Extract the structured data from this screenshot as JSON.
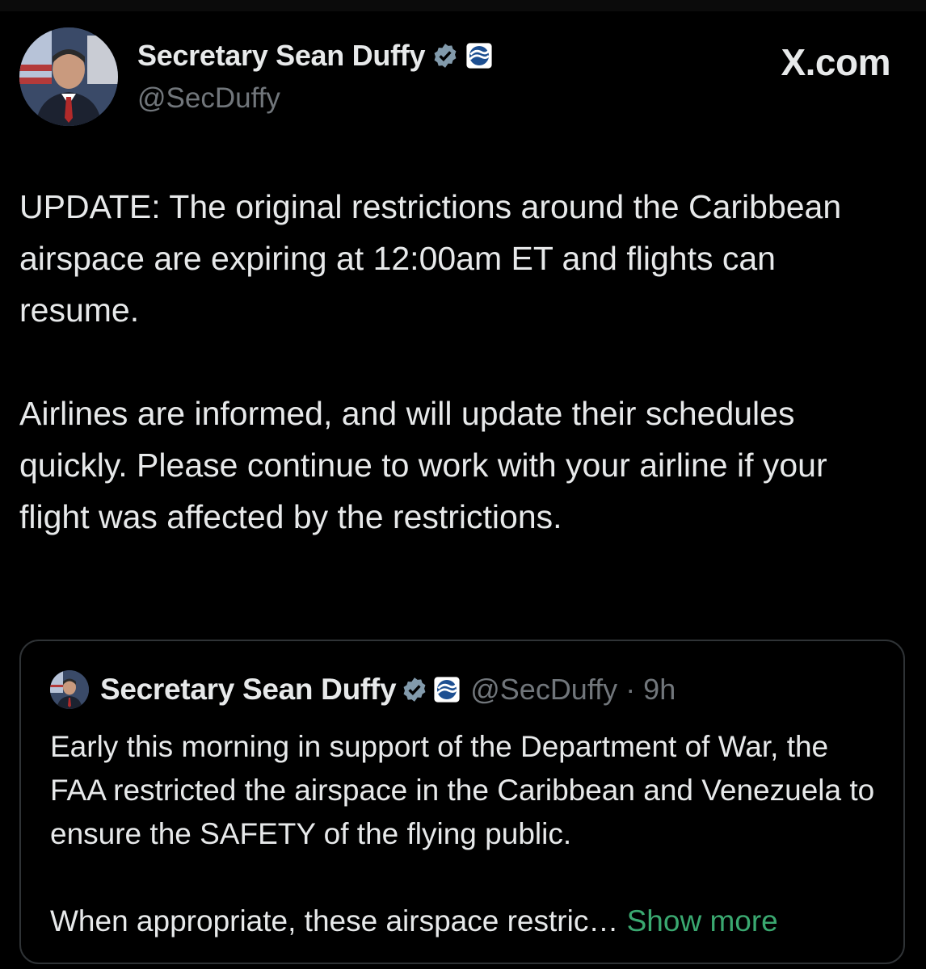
{
  "header": {
    "name": "Secretary Sean Duffy",
    "handle": "@SecDuffy",
    "site": "X.com"
  },
  "post": {
    "paragraphs": [
      "UPDATE: The original restrictions around the Caribbean airspace are expiring at 12:00am ET and flights can resume.",
      "Airlines are informed, and will update their schedules quickly. Please continue to work with your airline if your flight was affected by the restrictions."
    ]
  },
  "quote": {
    "name": "Secretary Sean Duffy",
    "handle_time": "@SecDuffy · 9h",
    "paragraphs": [
      "Early this morning in support of the Department of War, the FAA restricted the airspace in the Caribbean and Venezuela to ensure the SAFETY of the flying public.",
      "When appropriate, these airspace restric…"
    ],
    "show_more": "Show more"
  },
  "icons": {
    "verified": "verified-badge-icon",
    "affiliate": "dot-logo-affiliate-icon"
  },
  "colors": {
    "background": "#000000",
    "text": "#e7e9ea",
    "muted": "#71767b",
    "border": "#2f3336",
    "link": "#3aa870",
    "verified_badge": "#829aab",
    "affiliate_blue": "#1d4f91"
  }
}
